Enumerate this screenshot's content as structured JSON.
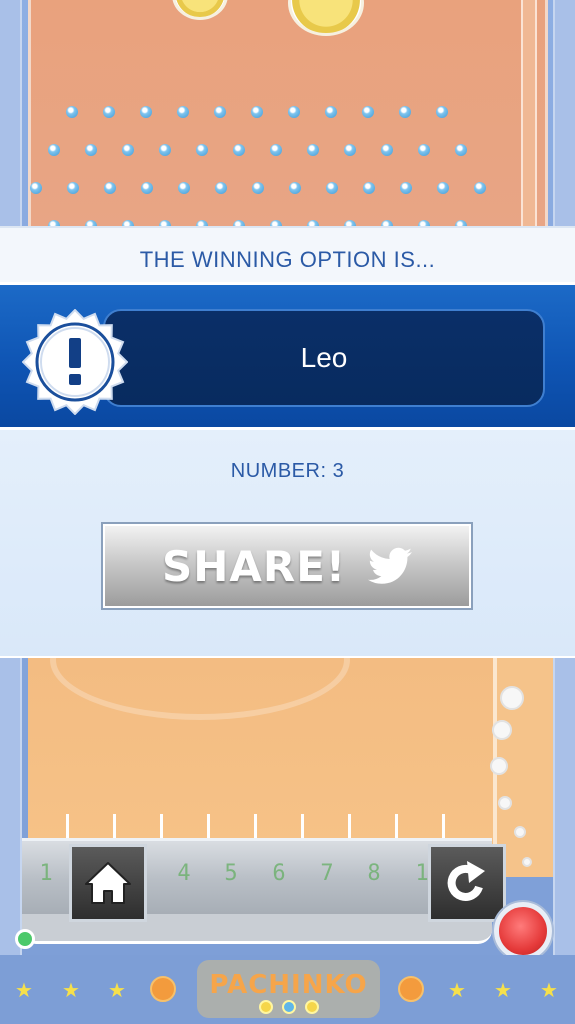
{
  "dialog": {
    "heading": "THE WINNING OPTION IS...",
    "result": "Leo",
    "number_label": "NUMBER: 3",
    "share_label": "SHARE!",
    "share_icon": "twitter-icon",
    "badge_icon": "exclamation-icon"
  },
  "board": {
    "slot_numbers": [
      "1",
      "4",
      "5",
      "6",
      "7",
      "8",
      "1"
    ],
    "home_icon": "home-icon",
    "replay_icon": "replay-icon"
  },
  "logo": {
    "text": "PACHINKO"
  },
  "colors": {
    "heading_text": "#2b5aa6",
    "result_band": "#0f55b4",
    "result_box": "#082b5f",
    "share_button": "#bdbdbd",
    "board_top": "#e9a27d",
    "board_bottom": "#f3bc82",
    "frame": "#7d9ed6"
  }
}
